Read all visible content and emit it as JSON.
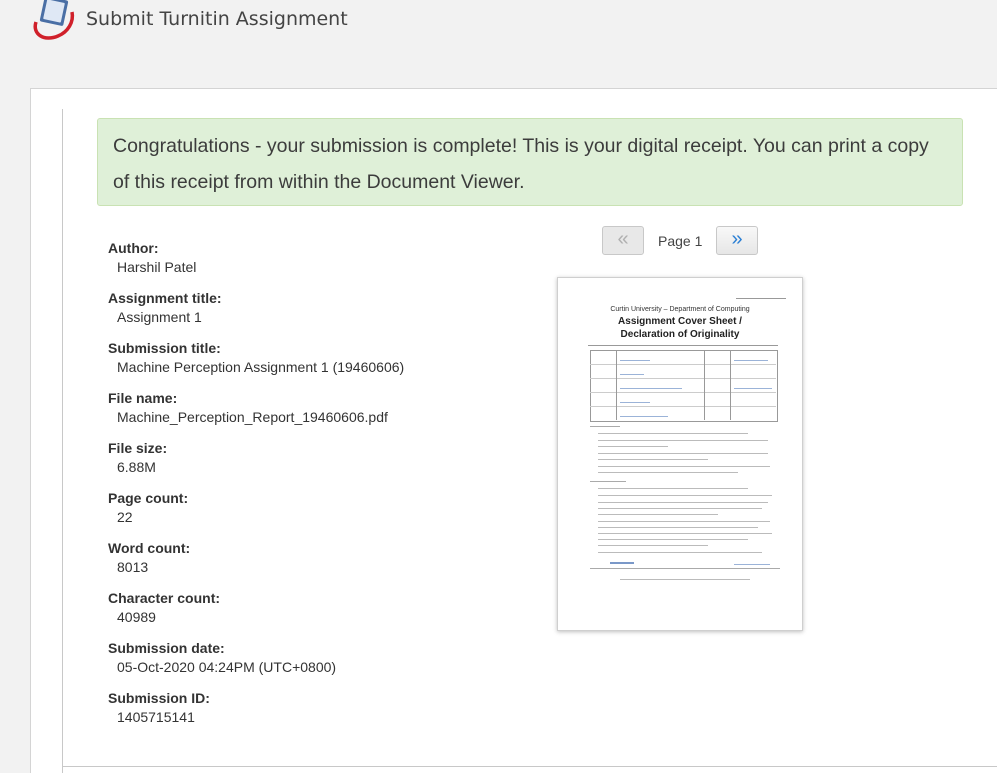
{
  "header": {
    "title": "Submit Turnitin Assignment",
    "logo_icon": "turnitin-logo-icon"
  },
  "alert": {
    "message": "Congratulations - your submission is complete! This is your digital receipt. You can print a copy of this receipt from within the Document Viewer."
  },
  "receipt": [
    {
      "label": "Author:",
      "value": "Harshil Patel"
    },
    {
      "label": "Assignment title:",
      "value": "Assignment 1"
    },
    {
      "label": "Submission title:",
      "value": "Machine Perception Assignment 1 (19460606)"
    },
    {
      "label": "File name:",
      "value": "Machine_Perception_Report_19460606.pdf"
    },
    {
      "label": "File size:",
      "value": "6.88M"
    },
    {
      "label": "Page count:",
      "value": "22"
    },
    {
      "label": "Word count:",
      "value": "8013"
    },
    {
      "label": "Character count:",
      "value": "40989"
    },
    {
      "label": "Submission date:",
      "value": "05-Oct-2020 04:24PM (UTC+0800)"
    },
    {
      "label": "Submission ID:",
      "value": "1405715141"
    }
  ],
  "viewer": {
    "prev_label": "«",
    "next_label": "»",
    "page_label": "Page 1"
  },
  "document": {
    "line1": "Curtin University – Department of Computing",
    "line2": "Assignment Cover Sheet /",
    "line3": "Declaration of Originality"
  },
  "colors": {
    "alert_bg": "#dff0d8",
    "link_blue": "#2a7fd4",
    "logo_red": "#d0202a"
  }
}
